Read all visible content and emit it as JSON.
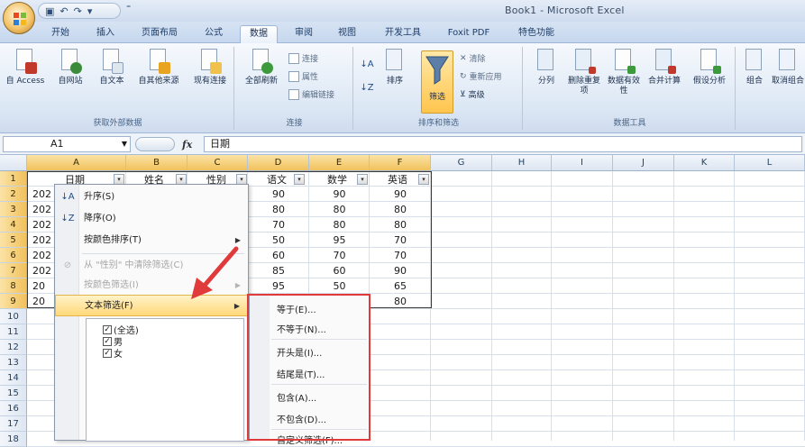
{
  "window": {
    "title": "Book1 - Microsoft Excel"
  },
  "qat": {
    "undo": "↶",
    "redo": "↷"
  },
  "tabs": [
    "开始",
    "插入",
    "页面布局",
    "公式",
    "数据",
    "审阅",
    "视图",
    "开发工具",
    "Foxit PDF",
    "特色功能"
  ],
  "ribbon": {
    "get_external": {
      "label": "获取外部数据",
      "buttons": [
        "自 Access",
        "自网站",
        "自文本",
        "自其他来源",
        "现有连接"
      ]
    },
    "connections": {
      "label": "连接",
      "refresh": "全部刷新",
      "small": [
        "连接",
        "属性",
        "编辑链接"
      ]
    },
    "sort_filter": {
      "label": "排序和筛选",
      "sort": "排序",
      "filter": "筛选",
      "small": [
        "清除",
        "重新应用",
        "高级"
      ]
    },
    "data_tools": {
      "label": "数据工具",
      "buttons": [
        "分列",
        "删除重复项",
        "数据有效性",
        "合并计算",
        "假设分析"
      ]
    },
    "outline": {
      "buttons": [
        "组合",
        "取消组合"
      ]
    }
  },
  "formula_bar": {
    "name_box": "A1",
    "fx": "fx",
    "content": "日期"
  },
  "grid": {
    "columns": [
      "A",
      "B",
      "C",
      "D",
      "E",
      "F",
      "G",
      "H",
      "I",
      "J",
      "K",
      "L"
    ],
    "rows": [
      "1",
      "2",
      "3",
      "4",
      "5",
      "6",
      "7",
      "8",
      "9",
      "10",
      "11",
      "12",
      "13",
      "14",
      "15",
      "16",
      "17",
      "18"
    ],
    "headers": [
      "日期",
      "姓名",
      "性别",
      "语文",
      "数学",
      "英语"
    ],
    "date_fragments": [
      "202",
      "202",
      "202",
      "202",
      "202",
      "202",
      "20",
      "20"
    ],
    "yuwen": [
      "90",
      "80",
      "70",
      "50",
      "60",
      "85",
      "95",
      ""
    ],
    "shuxue": [
      "90",
      "80",
      "80",
      "95",
      "70",
      "60",
      "50",
      ""
    ],
    "yingyu": [
      "90",
      "80",
      "80",
      "70",
      "70",
      "90",
      "65",
      "80"
    ]
  },
  "filter_menu": {
    "items": [
      {
        "label": "升序(S)",
        "icon": "↓A",
        "disabled": false
      },
      {
        "label": "降序(O)",
        "icon": "↓Z",
        "disabled": false
      },
      {
        "label": "按颜色排序(T)",
        "icon": "",
        "disabled": false
      },
      {
        "label": "从 \"性别\" 中清除筛选(C)",
        "icon": "⊘",
        "disabled": true
      },
      {
        "label": "按颜色筛选(I)",
        "icon": "",
        "disabled": true
      },
      {
        "label": "文本筛选(F)",
        "icon": "",
        "disabled": false
      }
    ],
    "checks": [
      "(全选)",
      "男",
      "女"
    ]
  },
  "text_filter_submenu": [
    "等于(E)...",
    "不等于(N)...",
    "开头是(I)...",
    "结尾是(T)...",
    "包含(A)...",
    "不包含(D)...",
    "自定义筛选(F)..."
  ],
  "colors": {
    "highlight": "#ffd879",
    "annotation": "#e03a3a"
  }
}
